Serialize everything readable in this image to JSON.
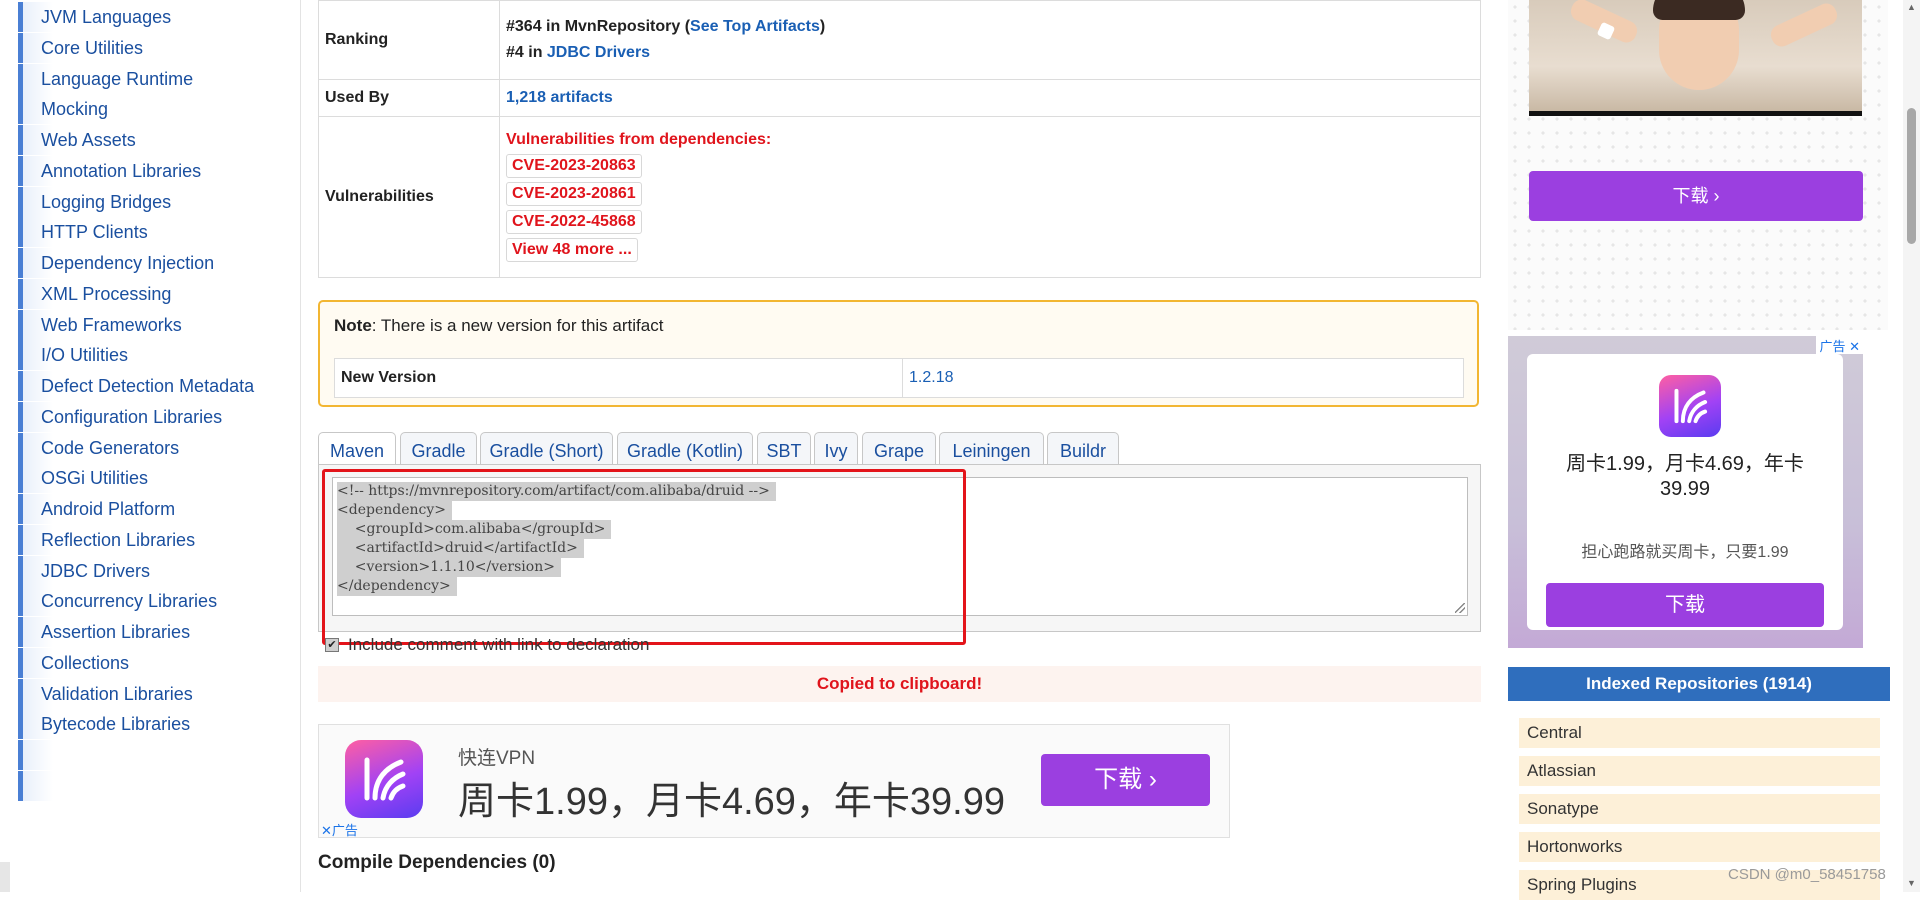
{
  "sidebar": {
    "categories": [
      "JVM Languages",
      "Core Utilities",
      "Language Runtime",
      "Mocking",
      "Web Assets",
      "Annotation Libraries",
      "Logging Bridges",
      "HTTP Clients",
      "Dependency Injection",
      "XML Processing",
      "Web Frameworks",
      "I/O Utilities",
      "Defect Detection Metadata",
      "Configuration Libraries",
      "Code Generators",
      "OSGi Utilities",
      "Android Platform",
      "Reflection Libraries",
      "JDBC Drivers",
      "Concurrency Libraries",
      "Assertion Libraries",
      "Collections",
      "Validation Libraries",
      "Bytecode Libraries"
    ]
  },
  "info": {
    "ranking_label": "Ranking",
    "ranking_line1_prefix": "#364 in MvnRepository (",
    "ranking_line1_link": "See Top Artifacts",
    "ranking_line1_suffix": ")",
    "ranking_line2_prefix": "#4 in ",
    "ranking_line2_link": "JDBC Drivers",
    "used_by_label": "Used By",
    "used_by_value": "1,218 artifacts",
    "vulnerabilities_label": "Vulnerabilities",
    "vulnerabilities_heading": "Vulnerabilities from dependencies:",
    "cves": [
      "CVE-2023-20863",
      "CVE-2023-20861",
      "CVE-2022-45868"
    ],
    "view_more": "View 48 more ..."
  },
  "note": {
    "label": "Note",
    "text": ": There is a new version for this artifact",
    "new_version_label": "New Version",
    "new_version_value": "1.2.18"
  },
  "build_tabs": [
    "Maven",
    "Gradle",
    "Gradle (Short)",
    "Gradle (Kotlin)",
    "SBT",
    "Ivy",
    "Grape",
    "Leiningen",
    "Buildr"
  ],
  "active_tab": "Maven",
  "code_lines": [
    "<!-- https://mvnrepository.com/artifact/com.alibaba/druid -->",
    "<dependency>",
    "    <groupId>com.alibaba</groupId>",
    "    <artifactId>druid</artifactId>",
    "    <version>1.1.10</version>",
    "</dependency>"
  ],
  "include_comment_label": "Include comment with link to declaration",
  "include_comment_checked": true,
  "copied_message": "Copied to clipboard!",
  "ad_wide": {
    "app_name": "快连VPN",
    "promo": "周卡1.99，月卡4.69，年卡39.99",
    "button": "下载 ›",
    "ad_mark": "广告"
  },
  "compile_dependencies_title": "Compile Dependencies (0)",
  "right": {
    "top_download_button": "下载 ›",
    "ad_square": {
      "corner_mark": "广告",
      "promo_line1": "周卡1.99，月卡4.69，年卡",
      "promo_line2": "39.99",
      "sub": "担心跑路就买周卡，只要1.99",
      "button": "下载"
    },
    "repos_header": "Indexed Repositories (1914)",
    "repos": [
      "Central",
      "Atlassian",
      "Sonatype",
      "Hortonworks",
      "Spring Plugins"
    ]
  },
  "watermark": "CSDN @m0_58451758",
  "colors": {
    "link": "#1a5fb4",
    "vulnerability_red": "#e0141c",
    "note_border": "#f2b632",
    "ad_button_purple": "#9b3fe0",
    "repo_header_blue": "#2f6ebd",
    "highlight_frame": "#e3141a"
  },
  "icons": {
    "ad_app_icon": "kuailian-logo-icon",
    "tab_close": "close-icon"
  }
}
